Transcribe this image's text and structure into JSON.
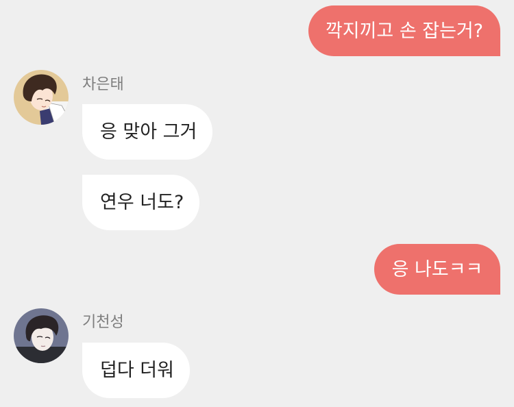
{
  "messages": {
    "m1": {
      "text": "깍지끼고 손 잡는거?"
    },
    "m2_sender": "차은태",
    "m2": {
      "text": "응 맞아 그거"
    },
    "m3": {
      "text": "연우 너도?"
    },
    "m4": {
      "text": "응 나도ㅋㅋ"
    },
    "m5_sender": "기천성",
    "m6": {
      "text": "덥다 더워"
    }
  },
  "colors": {
    "outgoing_bubble": "#ee716c",
    "incoming_bubble": "#ffffff",
    "background": "#efefef",
    "sender_name": "#7d7d7d"
  }
}
